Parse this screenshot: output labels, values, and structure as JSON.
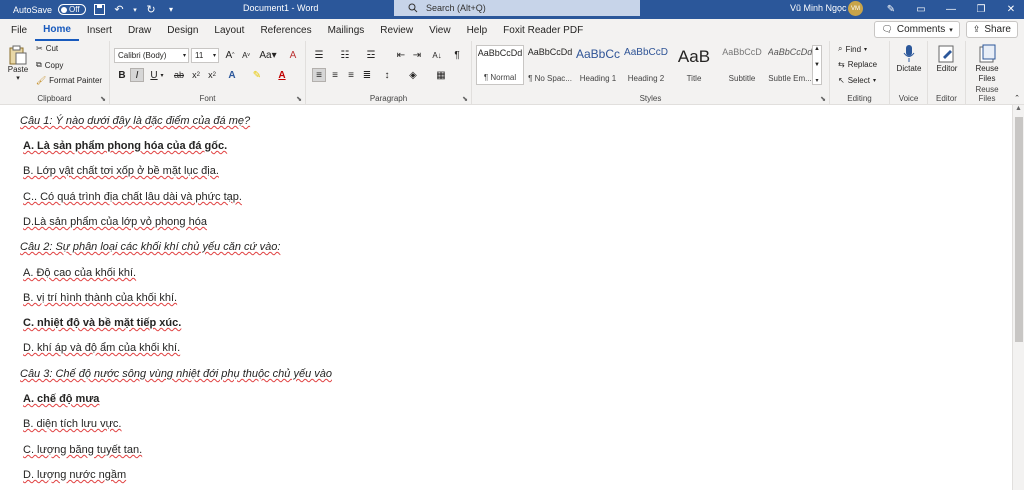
{
  "titlebar": {
    "autosave_label": "AutoSave",
    "autosave_state": "Off",
    "document_title": "Document1  -  Word",
    "search_placeholder": "Search (Alt+Q)",
    "user_name": "Vũ Minh Ngọc",
    "user_initials": "VM"
  },
  "tabs": [
    "File",
    "Home",
    "Insert",
    "Draw",
    "Design",
    "Layout",
    "References",
    "Mailings",
    "Review",
    "View",
    "Help",
    "Foxit Reader PDF"
  ],
  "active_tab": "Home",
  "actions": {
    "comments": "Comments",
    "share": "Share"
  },
  "ribbon": {
    "clipboard": {
      "label": "Clipboard",
      "paste": "Paste",
      "cut": "Cut",
      "copy": "Copy",
      "format_painter": "Format Painter"
    },
    "font": {
      "label": "Font",
      "font_name": "Calibri (Body)",
      "font_size": "11",
      "bold": "B",
      "italic": "I",
      "underline": "U"
    },
    "paragraph": {
      "label": "Paragraph"
    },
    "styles": {
      "label": "Styles",
      "items": [
        {
          "preview": "AaBbCcDd",
          "name": "¶ Normal"
        },
        {
          "preview": "AaBbCcDd",
          "name": "¶ No Spac..."
        },
        {
          "preview": "AaBbCc",
          "name": "Heading 1"
        },
        {
          "preview": "AaBbCcD",
          "name": "Heading 2"
        },
        {
          "preview": "AaB",
          "name": "Title"
        },
        {
          "preview": "AaBbCcD",
          "name": "Subtitle"
        },
        {
          "preview": "AaBbCcDd",
          "name": "Subtle Em..."
        }
      ]
    },
    "editing": {
      "label": "Editing",
      "find": "Find",
      "replace": "Replace",
      "select": "Select"
    },
    "voice": {
      "label": "Voice",
      "dictate": "Dictate"
    },
    "editor": {
      "label": "Editor",
      "editor": "Editor"
    },
    "reuse": {
      "label": "Reuse Files",
      "button": "Reuse Files"
    }
  },
  "document": {
    "paragraphs": [
      {
        "text": "Câu 1: Ý nào dưới đây là đặc điểm của đá mẹ?",
        "style": "question"
      },
      {
        "text": "A. Là sản phẩm phong hóa của đá gốc.",
        "style": "bold"
      },
      {
        "text": "B. Lớp vật chất tơi xốp ở bề mặt lục địa.",
        "style": "normal"
      },
      {
        "text": "C.. Có quá trình địa chất lâu dài và phức tạp.",
        "style": "normal"
      },
      {
        "text": "D.Là sản phẩm của lớp vỏ phong hóa",
        "style": "normal"
      },
      {
        "text": "Câu 2: Sự phân loại các khối khí chủ yếu căn cứ vào:",
        "style": "question"
      },
      {
        "text": "A. Độ cao của khối khí.",
        "style": "normal"
      },
      {
        "text": "B. vị trí hình thành của khối khí.",
        "style": "normal"
      },
      {
        "text": "C. nhiệt độ và bề mặt tiếp xúc.",
        "style": "bold"
      },
      {
        "text": "D. khí áp và độ ẩm của khối khí.",
        "style": "normal"
      },
      {
        "text": "Câu 3: Chế độ nước sông vùng nhiệt đới phụ thuộc chủ yếu vào",
        "style": "question"
      },
      {
        "text": "A. chế độ mưa",
        "style": "bold"
      },
      {
        "text": "B. diện tích lưu vực.",
        "style": "normal"
      },
      {
        "text": "C. lượng băng tuyết tan.",
        "style": "normal"
      },
      {
        "text": "D. lượng nước ngầm",
        "style": "normal"
      }
    ]
  }
}
